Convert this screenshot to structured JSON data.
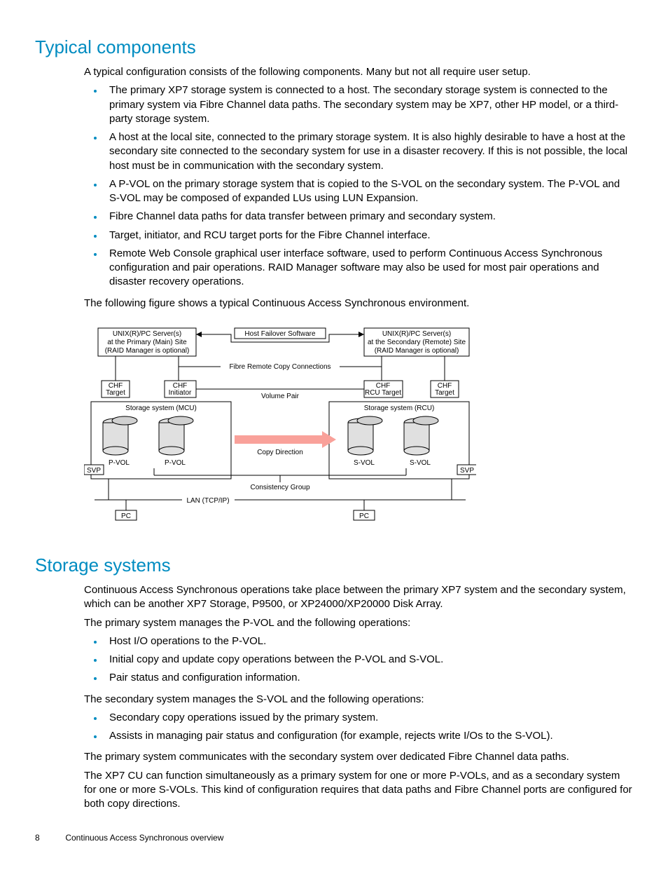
{
  "section1": {
    "heading": "Typical components",
    "intro": "A typical configuration consists of the following components. Many but not all require user setup.",
    "bullets": [
      "The primary XP7 storage system is connected to a host. The secondary storage system is connected to the primary system via Fibre Channel data paths. The secondary system may be XP7, other HP model, or a third-party storage system.",
      "A host at the local site, connected to the primary storage system. It is also highly desirable to have a host at the secondary site connected to the secondary system for use in a disaster recovery. If this is not possible, the local host must be in communication with the secondary system.",
      "A P-VOL on the primary storage system that is copied to the S-VOL on the secondary system. The P-VOL and S-VOL may be composed of expanded LUs using LUN Expansion.",
      "Fibre Channel data paths for data transfer between primary and secondary system.",
      "Target, initiator, and RCU target ports for the Fibre Channel interface.",
      "Remote Web Console graphical user interface software, used to perform Continuous Access Synchronous configuration and pair operations. RAID Manager software may also be used for most pair operations and disaster recovery operations."
    ],
    "figcaption": "The following figure shows a typical Continuous Access Synchronous environment."
  },
  "figure": {
    "top_left_box": [
      "UNIX(R)/PC Server(s)",
      "at the Primary (Main) Site",
      "(RAID Manager is optional)"
    ],
    "top_mid_box": "Host Failover Software",
    "top_right_box": [
      "UNIX(R)/PC Server(s)",
      "at the Secondary (Remote) Site",
      "(RAID Manager is optional)"
    ],
    "fibre_label": "Fibre Remote Copy Connections",
    "chf_target_l": [
      "CHF",
      "Target"
    ],
    "chf_init": [
      "CHF",
      "Initiator"
    ],
    "chf_rcu": [
      "CHF",
      "RCU Target"
    ],
    "chf_target_r": [
      "CHF",
      "Target"
    ],
    "volpair": "Volume Pair",
    "mcu_label": "Storage system (MCU)",
    "rcu_label": "Storage system (RCU)",
    "pvol": "P-VOL",
    "svol": "S-VOL",
    "copydir": "Copy Direction",
    "svp": "SVP",
    "consistency": "Consistency Group",
    "lan": "LAN (TCP/IP)",
    "pc": "PC"
  },
  "section2": {
    "heading": "Storage systems",
    "p1": "Continuous Access Synchronous operations take place between the primary XP7 system and the secondary system, which can be another XP7 Storage, P9500, or XP24000/XP20000 Disk Array.",
    "p2": "The primary system manages the P-VOL and the following operations:",
    "bullets1": [
      "Host I/O operations to the P-VOL.",
      "Initial copy and update copy operations between the P-VOL and S-VOL.",
      "Pair status and configuration information."
    ],
    "p3": "The secondary system manages the S-VOL and the following operations:",
    "bullets2": [
      "Secondary copy operations issued by the primary system.",
      "Assists in managing pair status and configuration (for example, rejects write I/Os to the S-VOL)."
    ],
    "p4": "The primary system communicates with the secondary system over dedicated Fibre Channel data paths.",
    "p5": "The XP7 CU can function simultaneously as a primary system for one or more P-VOLs, and as a secondary system for one or more S-VOLs. This kind of configuration requires that data paths and Fibre Channel ports are configured for both copy directions."
  },
  "footer": {
    "page": "8",
    "title": "Continuous Access Synchronous overview"
  }
}
